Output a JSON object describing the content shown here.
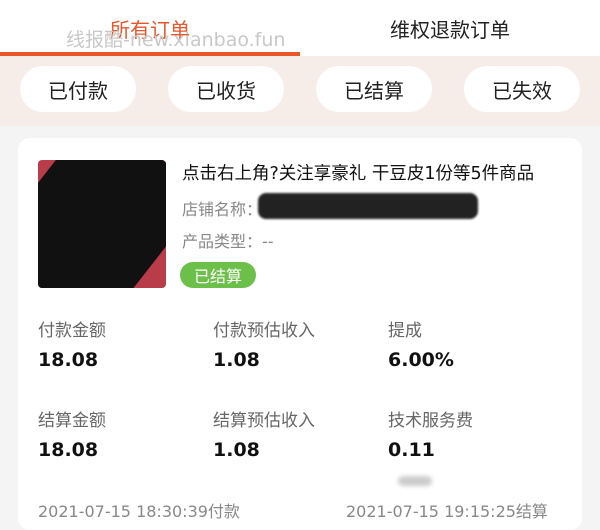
{
  "tabs": [
    {
      "label": "所有订单",
      "active": true
    },
    {
      "label": "维权退款订单",
      "active": false
    }
  ],
  "watermark": "线报酷-new.xianbao.fun",
  "filters": [
    "已付款",
    "已收货",
    "已结算",
    "已失效"
  ],
  "order": {
    "title": "点击右上角?关注享豪礼 干豆皮1份等5件商品",
    "shop_label": "店铺名称：",
    "product_type_label": "产品类型：",
    "product_type_value": "--",
    "status": "已结算",
    "stats": [
      {
        "label": "付款金额",
        "value": "18.08"
      },
      {
        "label": "付款预估收入",
        "value": "1.08"
      },
      {
        "label": "提成",
        "value": "6.00%"
      },
      {
        "label": "结算金额",
        "value": "18.08"
      },
      {
        "label": "结算预估收入",
        "value": "1.08"
      },
      {
        "label": "技术服务费",
        "value": "0.11"
      }
    ],
    "pay_time": "2021-07-15 18:30:39付款",
    "settle_time": "2021-07-15 19:15:25结算"
  },
  "colors": {
    "accent": "#e8562a",
    "status_green": "#6cc04a",
    "filter_bg": "#f6ede9"
  }
}
